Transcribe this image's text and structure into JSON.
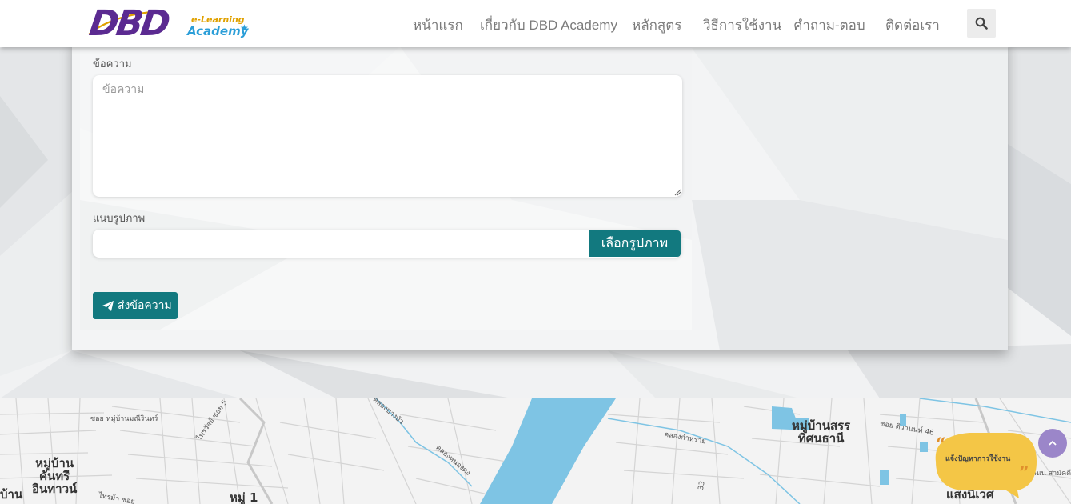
{
  "header": {
    "logo": {
      "main": "DBD",
      "sub_top": "e-Learning",
      "sub_bottom": "Academy"
    },
    "nav": [
      {
        "label": "หน้าแรก"
      },
      {
        "label": "เกี่ยวกับ DBD Academy"
      },
      {
        "label": "หลักสูตร"
      },
      {
        "label": "วิธีการใช้งาน"
      },
      {
        "label": "คำถาม-ตอบ"
      },
      {
        "label": "ติดต่อเรา"
      }
    ],
    "search_icon": "search-icon"
  },
  "form": {
    "message_label": "ข้อความ",
    "message_placeholder": "ข้อความ",
    "message_value": "",
    "attach_label": "แนบรูปภาพ",
    "attach_value": "",
    "attach_button": "เลือกรูปภาพ",
    "send_button": "ส่งข้อความ",
    "send_icon": "paper-plane-icon"
  },
  "map": {
    "labels": [
      {
        "text": "หมู่บ้าน\nคันทรี\nอินทาวน์"
      },
      {
        "text": "หมู่ 1"
      },
      {
        "text": "หมู่บ้านสรร\nทิศนธานี"
      },
      {
        "text": "หมู่บ้าน\nแสงนิเวศ"
      }
    ],
    "small_labels": [
      {
        "text": "ซอย หมู่บ้านมณีรินทร์"
      },
      {
        "text": "ไพรวัลย์ ซอย 5"
      },
      {
        "text": "คลองบางบัว"
      },
      {
        "text": "คลองหนองดง"
      },
      {
        "text": "คลองกำหราย"
      },
      {
        "text": "ซอย ติวานนท์ 46"
      },
      {
        "text": "ไทรม้า ซอย"
      },
      {
        "text": "ถนน สามัคคี"
      },
      {
        "text": "บ้าน"
      },
      {
        "text": "33"
      }
    ]
  },
  "widgets": {
    "report_text": "แจ้งปัญหาการใช้งาน",
    "scroll_top_icon": "chevron-up-icon"
  },
  "colors": {
    "brand_purple": "#5b2a91",
    "accent_teal": "#12797f",
    "river": "#7ec4e4",
    "nav_text": "#7b7b7b"
  }
}
